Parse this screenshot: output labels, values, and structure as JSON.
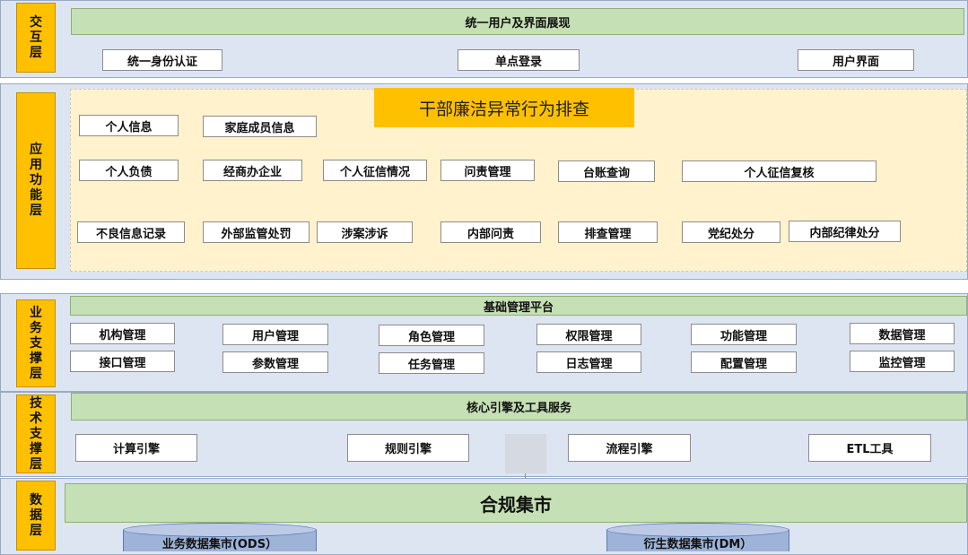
{
  "layers": {
    "interaction": "交互层",
    "application": "应用功能层",
    "business": "业务支撑层",
    "technical": "技术支撑层",
    "data": "数据层"
  },
  "interaction": {
    "bar": "统一用户及界面展现",
    "items": [
      "统一身份认证",
      "单点登录",
      "用户界面"
    ]
  },
  "application": {
    "title": "干部廉洁异常行为排查",
    "row1": [
      "个人信息",
      "家庭成员信息"
    ],
    "row2": [
      "个人负债",
      "经商办企业",
      "个人征信情况",
      "问责管理",
      "台账查询",
      "个人征信复核"
    ],
    "row3": [
      "不良信息记录",
      "外部监管处罚",
      "涉案涉诉",
      "内部问责",
      "排查管理",
      "党纪处分",
      "内部纪律处分"
    ]
  },
  "business": {
    "bar": "基础管理平台",
    "row1": [
      "机构管理",
      "用户管理",
      "角色管理",
      "权限管理",
      "功能管理",
      "数据管理"
    ],
    "row2": [
      "接口管理",
      "参数管理",
      "任务管理",
      "日志管理",
      "配置管理",
      "监控管理"
    ]
  },
  "technical": {
    "bar": "核心引擎及工具服务",
    "items": [
      "计算引擎",
      "规则引擎",
      "流程引擎",
      "ETL工具"
    ]
  },
  "data": {
    "bar": "合规集市",
    "stores": [
      "业务数据集市(ODS）",
      "衍生数据集市(DM）"
    ]
  },
  "colors": {
    "band": "#dde5f2",
    "layer_label": "#ffc000",
    "green_bar": "#c5e0b4",
    "app_area": "#fff2cc",
    "db": "#9db3d8"
  }
}
